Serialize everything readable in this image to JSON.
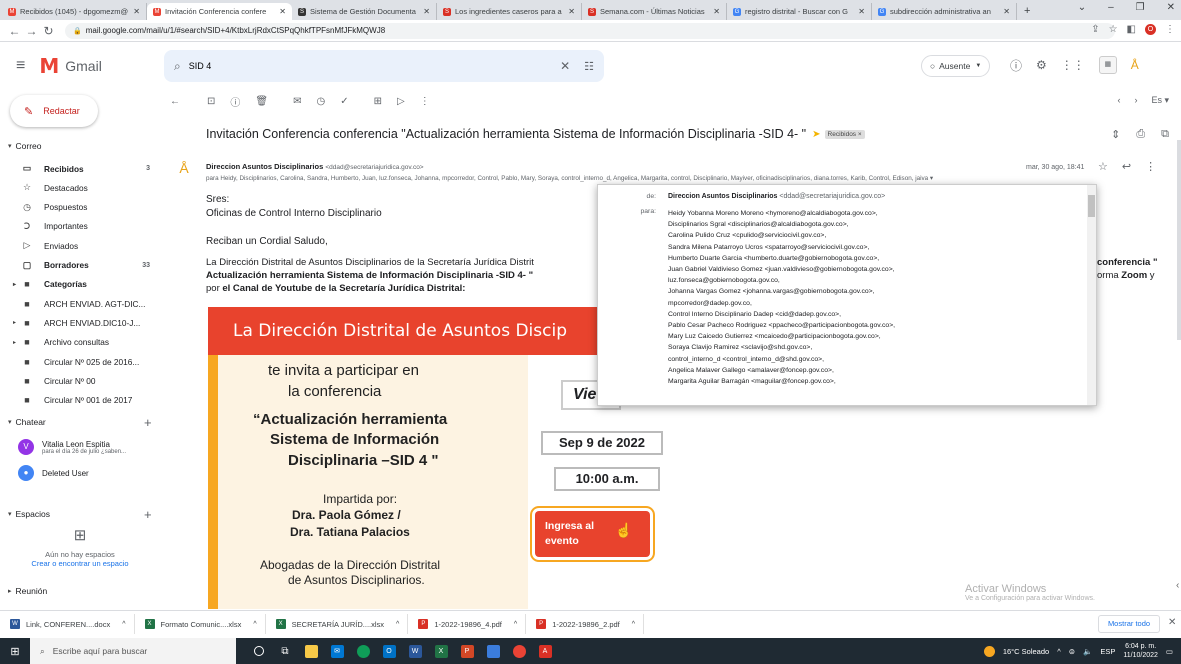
{
  "browser": {
    "tabs": [
      {
        "title": "Recibidos (1045) - dpgomezm@",
        "fav": "M",
        "color": "#ea4335",
        "active": false
      },
      {
        "title": "Invitación Conferencia confere",
        "fav": "M",
        "color": "#ea4335",
        "active": true
      },
      {
        "title": "Sistema de Gestión Documenta",
        "fav": "S",
        "color": "#333333",
        "active": false
      },
      {
        "title": "Los ingredientes caseros para a",
        "fav": "S",
        "color": "#d93025",
        "active": false
      },
      {
        "title": "Semana.com - Últimas Noticias",
        "fav": "S",
        "color": "#d93025",
        "active": false
      },
      {
        "title": "registro distrital - Buscar con G",
        "fav": "G",
        "color": "#4285f4",
        "active": false
      },
      {
        "title": "subdirección administrativa an",
        "fav": "G",
        "color": "#4285f4",
        "active": false
      }
    ],
    "new_tab": "+",
    "url": "mail.google.com/mail/u/1/#search/SID+4/KtbxLrjRdxCtSPqQhkfTPFsnMfJFkMQWJ8",
    "profile_letter": "O"
  },
  "gmail": {
    "logo_text": "Gmail",
    "search_value": "SID 4",
    "status": "Ausente",
    "compose": "Redactar"
  },
  "sidebar": {
    "section_mail": "Correo",
    "items": [
      {
        "label": "Recibidos",
        "count": "3",
        "bold": true,
        "icon": "▭"
      },
      {
        "label": "Destacados",
        "count": "",
        "bold": false,
        "icon": "☆"
      },
      {
        "label": "Pospuestos",
        "count": "",
        "bold": false,
        "icon": "◷"
      },
      {
        "label": "Importantes",
        "count": "",
        "bold": false,
        "icon": "Ↄ"
      },
      {
        "label": "Enviados",
        "count": "",
        "bold": false,
        "icon": "▷"
      },
      {
        "label": "Borradores",
        "count": "33",
        "bold": true,
        "icon": "▢"
      },
      {
        "label": "Categorías",
        "count": "",
        "bold": true,
        "icon": "■",
        "expand": true
      },
      {
        "label": "ARCH ENVIAD. AGT-DIC...",
        "count": "",
        "bold": false,
        "icon": "■"
      },
      {
        "label": "ARCH ENVIAD.DIC10-J...",
        "count": "",
        "bold": false,
        "icon": "■",
        "expand": true
      },
      {
        "label": "Archivo consultas",
        "count": "",
        "bold": false,
        "icon": "■",
        "expand": true
      },
      {
        "label": "Circular Nº 025 de 2016...",
        "count": "",
        "bold": false,
        "icon": "■"
      },
      {
        "label": "Circular Nº 00",
        "count": "",
        "bold": false,
        "icon": "■"
      },
      {
        "label": "Circular Nº 001 de 2017",
        "count": "",
        "bold": false,
        "icon": "■"
      }
    ],
    "section_chat": "Chatear",
    "chats": [
      {
        "name": "Vitalia Leon Espitia",
        "sub": "para el día 26 de julio ¿saben...",
        "initial": "V",
        "color": "#9334e6"
      },
      {
        "name": "Deleted User",
        "sub": "",
        "initial": "●",
        "color": "#4285f4"
      }
    ],
    "section_spaces": "Espacios",
    "spaces_empty": "Aún no hay espacios",
    "spaces_link": "Crear o encontrar un espacio",
    "section_meet": "Reunión"
  },
  "email": {
    "subject": "Invitación Conferencia conferencia \"Actualización herramienta Sistema de Información Disciplinaria -SID 4- \"",
    "label": "Recibidos ×",
    "sender_name": "Direccion Asuntos Disciplinarios",
    "sender_addr": "<ddad@secretariajuridica.gov.co>",
    "recipients": "para Heidy, Disciplinarios, Carolina, Sandra, Humberto, Juan, luz.fonseca, Johanna, mpcorredor, Control, Pablo, Mary, Soraya, control_interno_d, Angelica, Margarita, control, Disciplinario, Mayiver, oficinadisciplinarios, diana.torres, Karib, Control, Edison, jaiva ▾",
    "date": "mar, 30 ago, 18:41",
    "greet1": "Sres:",
    "greet2": "Oficinas de Control Interno Disciplinario",
    "greet3": "Reciban un Cordial Saludo,",
    "para_a": "La Dirección Distrital de Asuntos Disciplinarios de la Secretaría Jurídica Distrit",
    "para_b": "Actualización herramienta Sistema de Información Disciplinaria -SID 4- \"",
    "para_c1": "por ",
    "para_c2": "el Canal de Youtube de la Secretaría Jurídica Distrital:",
    "para_r1": "conferencia \"",
    "para_r2a": "orma ",
    "para_r2b": "Zoom",
    "para_r2c": " y"
  },
  "poster": {
    "title": "La Dirección Distrital de Asuntos Discip",
    "invite1": "te invita a participar en",
    "invite2": "la conferencia",
    "conf1": "“Actualización herramienta",
    "conf2": "Sistema de Información",
    "conf3": "Disciplinaria –SID 4 \"",
    "impartida": "Impartida por:",
    "dra1": "Dra. Paola Gómez /",
    "dra2": "Dra. Tatiana Palacios",
    "abog1": "Abogadas de la Dirección Distrital",
    "abog2": "de Asuntos Disciplinarios.",
    "vie": "Vie",
    "date": "Sep 9 de 2022",
    "time": "10:00 a.m.",
    "btn1": "Ingresa al",
    "btn2": "evento"
  },
  "popup": {
    "de_label": "de:",
    "para_label": "para:",
    "from_name": "Direccion Asuntos Disciplinarios",
    "from_addr": "<ddad@secretariajuridica.gov.co>",
    "to": [
      "Heidy Yobanna Moreno Moreno <hymoreno@alcaldiabogota.gov.co>,",
      "Disciplinarios Sgral <disciplinarios@alcaldiabogota.gov.co>,",
      "Carolina Pulido Cruz <cpulido@serviciocivil.gov.co>,",
      "Sandra Milena Patarroyo Ucros <spatarroyo@serviciocivil.gov.co>,",
      "Humberto Duarte Garcia <humberto.duarte@gobiernobogota.gov.co>,",
      "Juan Gabriel Valdivieso Gomez <juan.valdivieso@gobiernobogota.gov.co>,",
      "luz.fonseca@gobiernobogota.gov.co,",
      "Johanna Vargas Gomez <johanna.vargas@gobiernobogota.gov.co>,",
      "mpcorredor@dadep.gov.co,",
      "Control Interno Disciplinario Dadep <cid@dadep.gov.co>,",
      "Pablo Cesar Pacheco Rodriguez <ppacheco@participacionbogota.gov.co>,",
      "Mary Luz Caicedo Gutierrez <mcaicedo@participacionbogota.gov.co>,",
      "Soraya Clavijo Ramirez <sclavijo@shd.gov.co>,",
      "control_interno_d <control_interno_d@shd.gov.co>,",
      "Angelica Malaver Gallego <amalaver@foncep.gov.co>,",
      "Margarita Aguilar Barragán <maguilar@foncep.gov.co>,"
    ]
  },
  "watermark": {
    "line1": "Activar Windows",
    "line2": "Ve a Configuración para activar Windows."
  },
  "downloads": [
    {
      "name": "Link, CONFEREN....docx",
      "type": "W",
      "color": "#2b579a"
    },
    {
      "name": "Formato Comunic....xlsx",
      "type": "X",
      "color": "#217346"
    },
    {
      "name": "SECRETARÍA JURÍD....xlsx",
      "type": "X",
      "color": "#217346"
    },
    {
      "name": "1-2022-19896_4.pdf",
      "type": "P",
      "color": "#d93025"
    },
    {
      "name": "1-2022-19896_2.pdf",
      "type": "P",
      "color": "#d93025"
    }
  ],
  "show_all": "Mostrar todo",
  "taskbar": {
    "search_placeholder": "Escribe aquí para buscar",
    "weather": "16°C Soleado",
    "lang": "ESP",
    "time": "6:04 p. m.",
    "date": "11/10/2022"
  }
}
